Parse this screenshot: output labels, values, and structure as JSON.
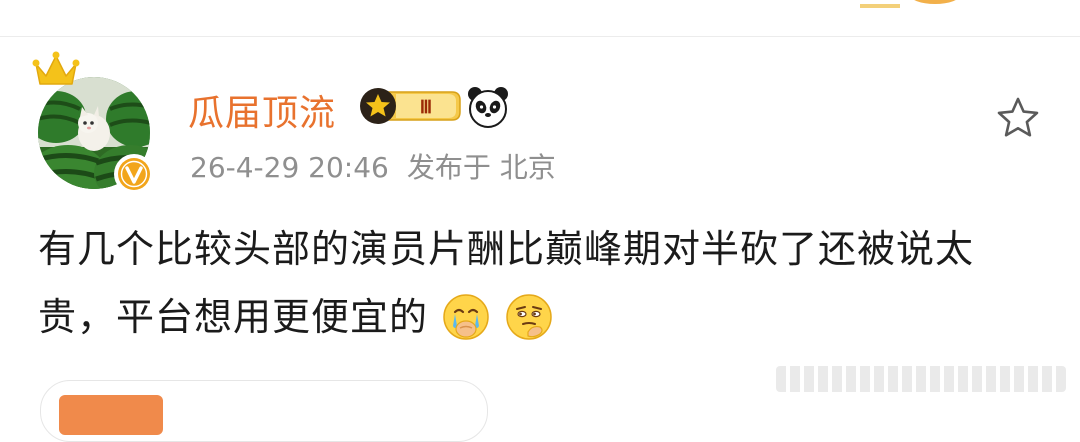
{
  "top_strip": {
    "cut_text": ""
  },
  "post": {
    "username": "瓜届顶流",
    "fan_badge_level": "Ⅲ",
    "timestamp": "26-4-29 20:46",
    "publish_label": "发布于",
    "location": "北京",
    "content": "有几个比较头部的演员片酬比巅峰期对半砍了还被说太贵，平台想用更便宜的"
  },
  "bottom_card": {
    "title": ""
  },
  "icons": {
    "crown": "crown-icon",
    "verified": "verified-v-icon",
    "fan_badge": "fan-level-badge-icon",
    "panda": "panda-icon",
    "star": "star-outline-icon",
    "emoji_cry": "crying-face-emoji-icon",
    "emoji_think": "thinking-face-emoji-icon"
  },
  "colors": {
    "username": "#e8722e",
    "meta_text": "#8f8f8f",
    "content_text": "#1b1b1b",
    "verified_badge": "#f2a51b",
    "crown": "#f4c21a"
  }
}
